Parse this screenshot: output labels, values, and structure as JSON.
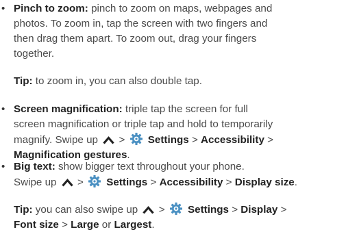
{
  "bullet_char": "•",
  "gt": ">",
  "pinch": {
    "term": "Pinch to zoom:",
    "l1": " pinch to zoom on maps, webpages and",
    "l2": "photos. To zoom in, tap the screen with two fingers and",
    "l3": "then drag them apart. To zoom out, drag your fingers",
    "l4": "together."
  },
  "tip1": {
    "label": "Tip:",
    "text": " to zoom in, you can also double tap."
  },
  "magnification": {
    "term": "Screen magnification:",
    "l1": " triple tap the screen for full",
    "l2": "screen magnification or triple tap and hold to temporarily",
    "l3": "magnify. Swipe up",
    "settings": "Settings",
    "accessibility": "Accessibility",
    "gestures": "Magnification gestures",
    "end": "."
  },
  "bigtext": {
    "term": "Big text:",
    "l1": " show bigger text throughout your phone.",
    "swipe": "Swipe up",
    "settings": "Settings",
    "accessibility": "Accessibility",
    "display_size": "Display size",
    "end": "."
  },
  "tip2": {
    "label": "Tip:",
    "text": " you can also swipe up",
    "settings": "Settings",
    "display": "Display",
    "font_size": "Font size",
    "large": "Large",
    "or": " or ",
    "largest": "Largest",
    "end": "."
  },
  "icons": {
    "chevron": "chevron-up-icon",
    "gear": "settings-gear-icon",
    "gear_color": "#4a90c2",
    "chevron_color": "#222222"
  }
}
